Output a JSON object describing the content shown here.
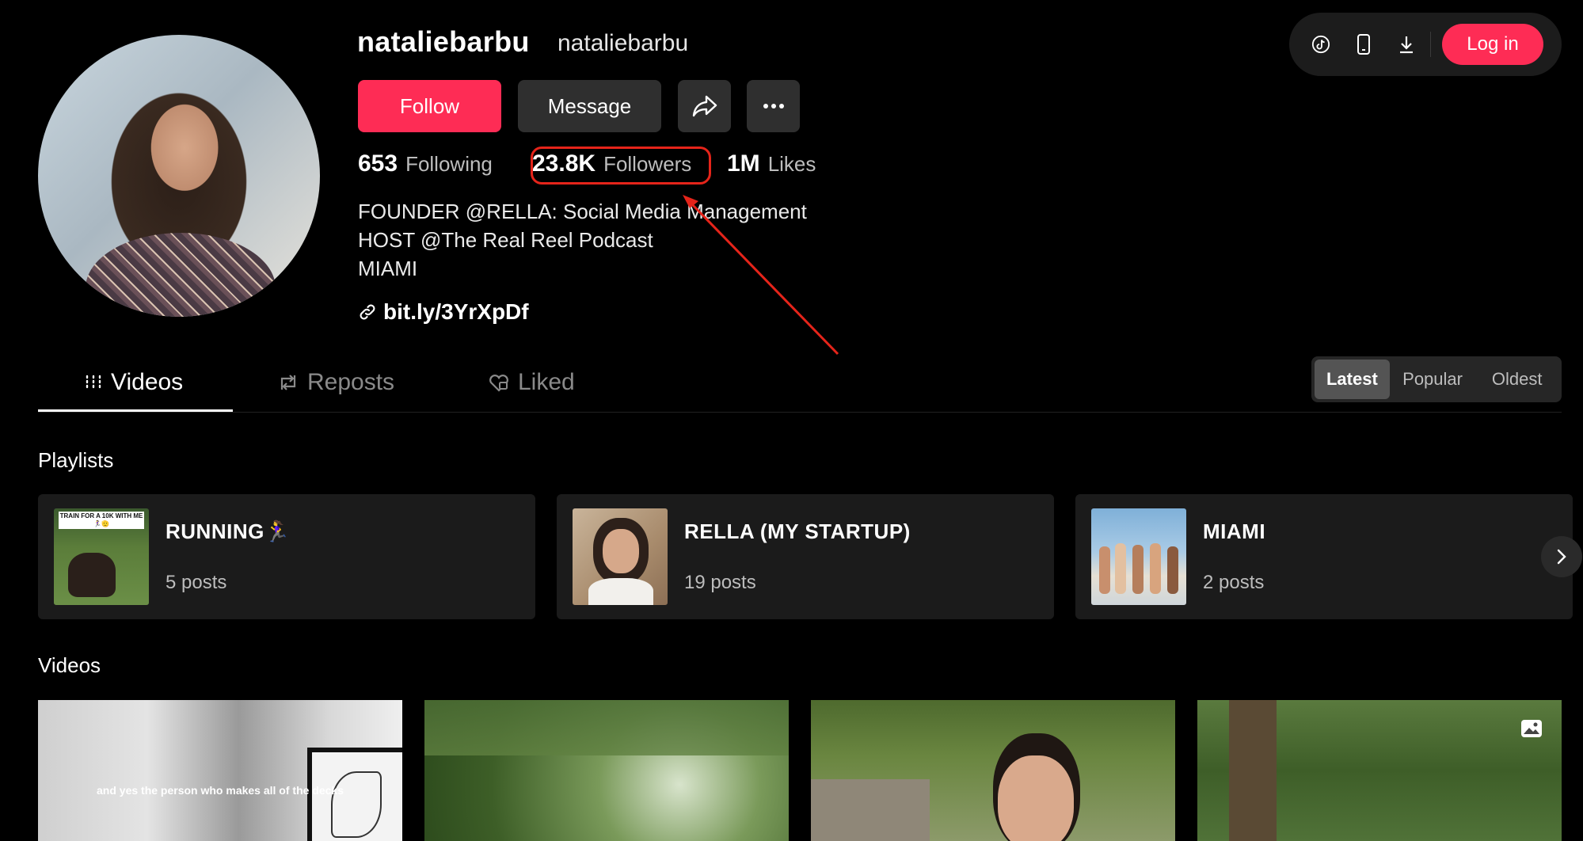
{
  "topbar": {
    "icons": [
      "tiktok-logo-icon",
      "phone-icon",
      "download-icon"
    ],
    "login_label": "Log in"
  },
  "profile": {
    "username": "nataliebarbu",
    "nickname": "nataliebarbu",
    "follow_label": "Follow",
    "message_label": "Message",
    "stats": {
      "following_count": "653",
      "following_label": "Following",
      "followers_count": "23.8K",
      "followers_label": "Followers",
      "likes_count": "1M",
      "likes_label": "Likes"
    },
    "bio": [
      "FOUNDER @RELLA: Social Media Management",
      "HOST @The Real Reel Podcast",
      "MIAMI"
    ],
    "link": "bit.ly/3YrXpDf"
  },
  "tabs": [
    {
      "label": "Videos",
      "active": true
    },
    {
      "label": "Reposts",
      "active": false
    },
    {
      "label": "Liked",
      "active": false
    }
  ],
  "sort": {
    "options": [
      "Latest",
      "Popular",
      "Oldest"
    ],
    "selected": "Latest"
  },
  "playlists_section": {
    "title": "Playlists",
    "items": [
      {
        "title": "RUNNING🏃‍♀️",
        "count": "5 posts",
        "thumb_caption": "TRAIN FOR A 10K WITH ME🏃‍♀️🫡"
      },
      {
        "title": "RELLA (MY STARTUP)",
        "count": "19 posts"
      },
      {
        "title": "MIAMI",
        "count": "2 posts"
      }
    ]
  },
  "videos_section": {
    "title": "Videos",
    "items": [
      {
        "caption": "and yes the person who makes all of the decks"
      },
      {
        "caption": ""
      },
      {
        "caption": ""
      },
      {
        "caption": ""
      }
    ]
  },
  "colors": {
    "accent": "#fe2c55",
    "annotation": "#e5241a",
    "background": "#000000"
  }
}
